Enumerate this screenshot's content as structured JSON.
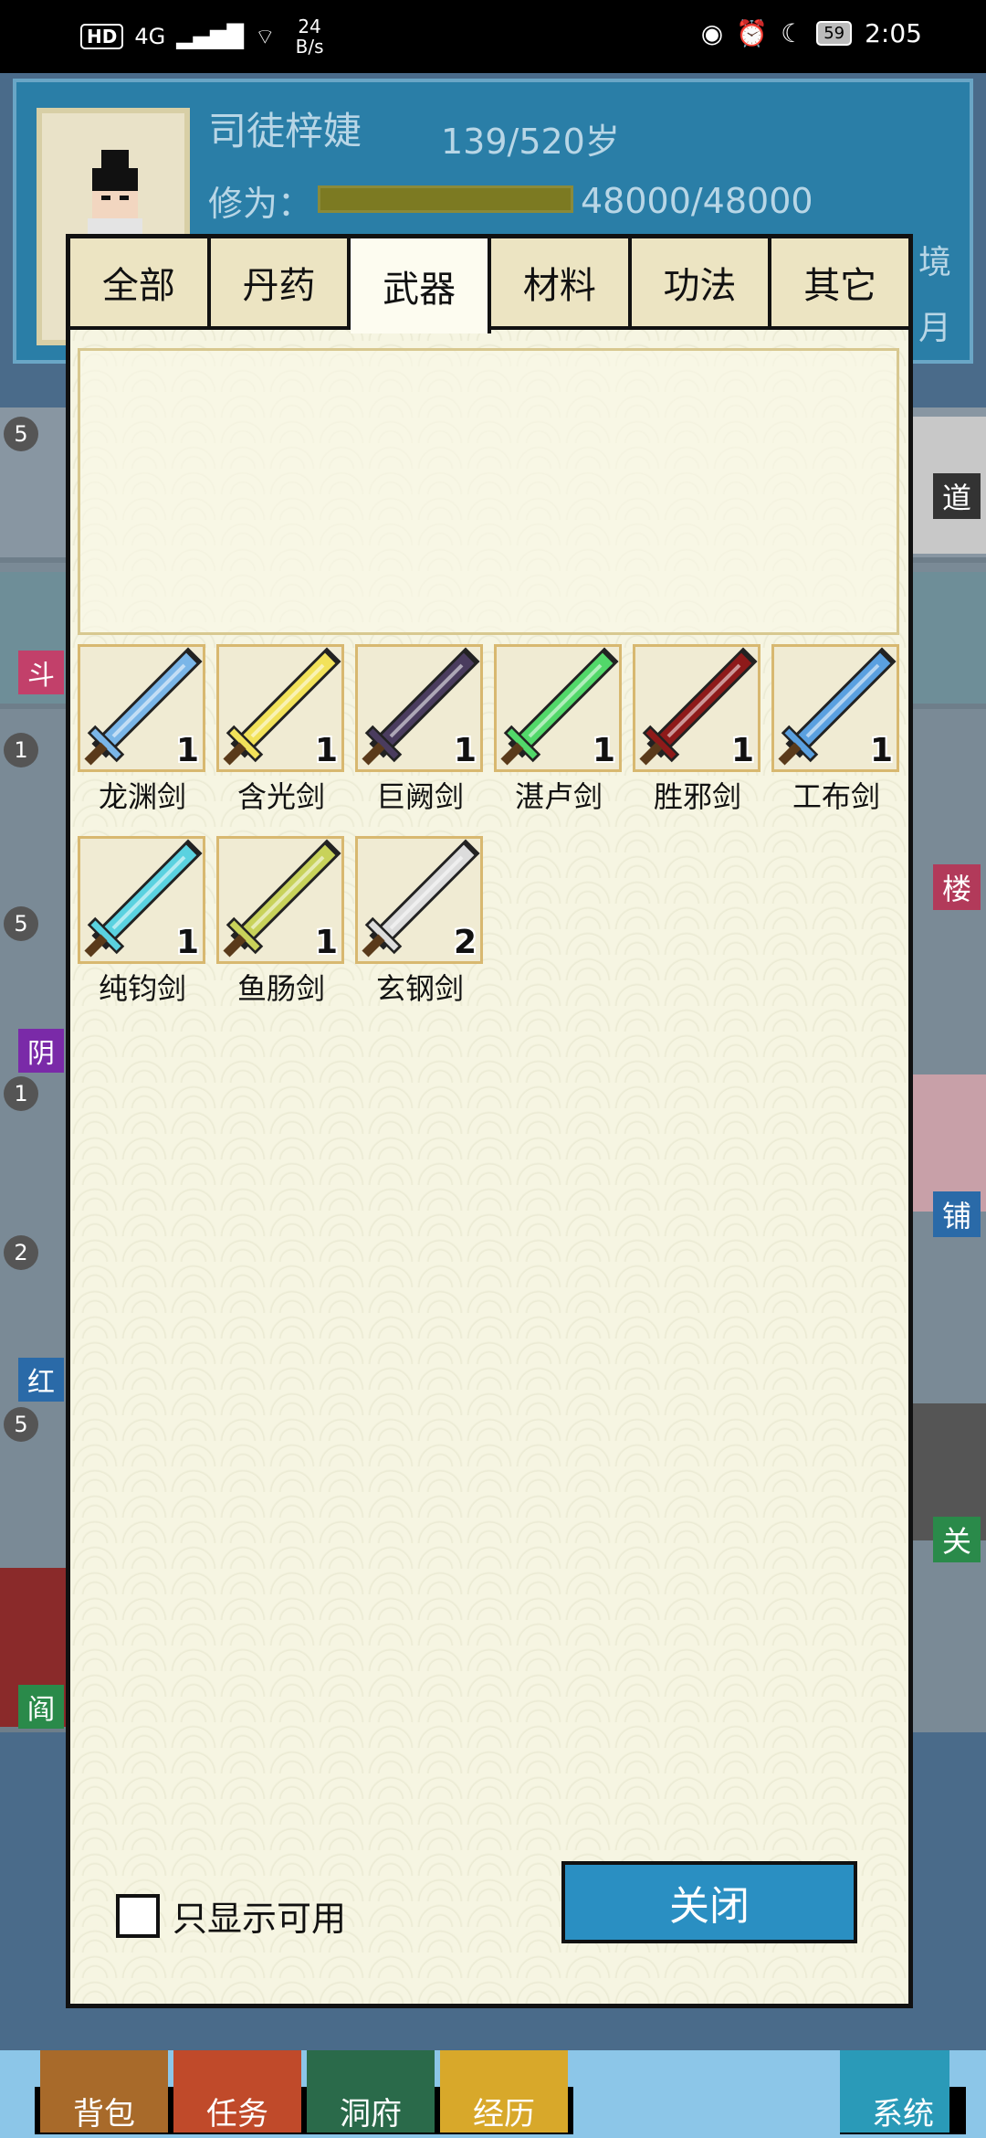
{
  "status_bar": {
    "hd": "HD",
    "network": "4G",
    "speed_value": "24",
    "speed_unit": "B/s",
    "battery": "59",
    "time": "2:05"
  },
  "profile": {
    "name": "司徒梓婕",
    "age": "139/520岁",
    "cultivation_label": "修为：",
    "cultivation_value": "48000/48000",
    "cultivation_progress": 1.0,
    "side_text_1": "境",
    "side_text_2": "月"
  },
  "background_list": {
    "badges": [
      "5",
      "1",
      "5",
      "1",
      "2",
      "5"
    ],
    "left_tags": [
      "斗",
      "阴",
      "红",
      "阎"
    ],
    "right_tags": [
      "道",
      "境",
      "楼",
      "铺",
      "关"
    ],
    "right_tag_top": "3"
  },
  "bottom_nav": {
    "items": [
      "背包",
      "任务",
      "洞府",
      "经历",
      "系统"
    ]
  },
  "inventory": {
    "tabs": [
      "全部",
      "丹药",
      "武器",
      "材料",
      "功法",
      "其它"
    ],
    "active_tab": "武器",
    "items": [
      {
        "name": "龙渊剑",
        "count": "1",
        "color": "#7ab6e8"
      },
      {
        "name": "含光剑",
        "count": "1",
        "color": "#f2e25a"
      },
      {
        "name": "巨阙剑",
        "count": "1",
        "color": "#4a3c5e"
      },
      {
        "name": "湛卢剑",
        "count": "1",
        "color": "#52d86a"
      },
      {
        "name": "胜邪剑",
        "count": "1",
        "color": "#8e1a1a"
      },
      {
        "name": "工布剑",
        "count": "1",
        "color": "#5aa0e0"
      },
      {
        "name": "纯钧剑",
        "count": "1",
        "color": "#5ad2e0"
      },
      {
        "name": "鱼肠剑",
        "count": "1",
        "color": "#c8d25a"
      },
      {
        "name": "玄钢剑",
        "count": "2",
        "color": "#dcdcdc"
      }
    ],
    "filter_label": "只显示可用",
    "filter_checked": false,
    "close_label": "关闭"
  }
}
